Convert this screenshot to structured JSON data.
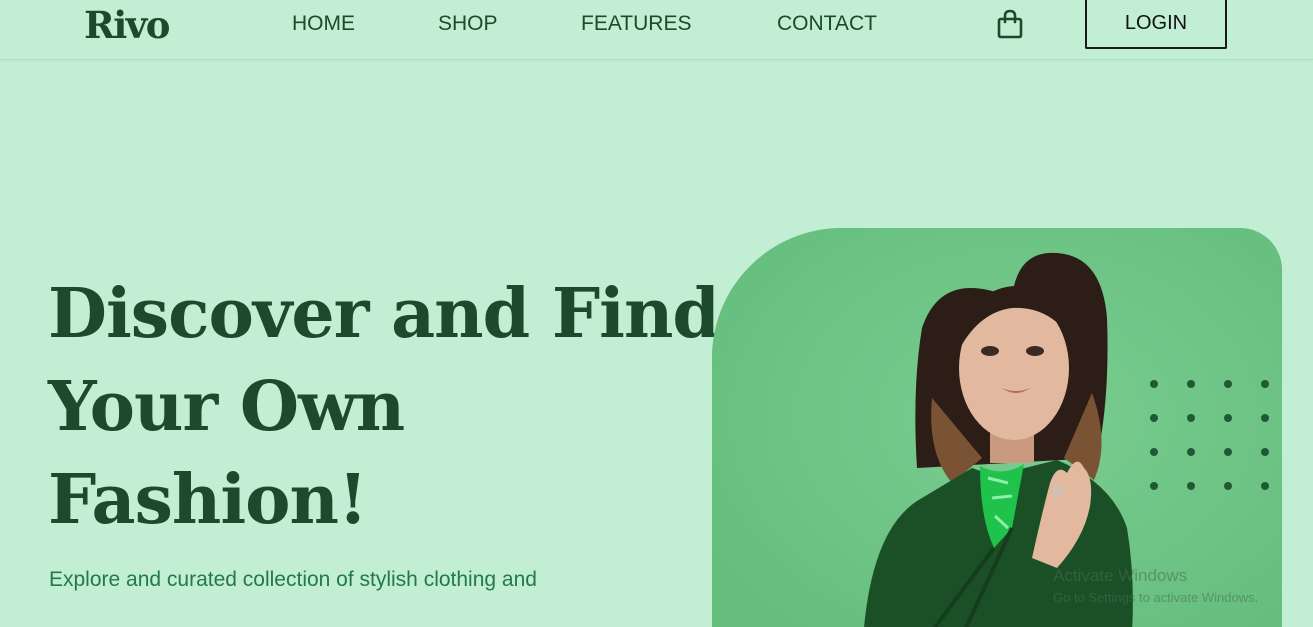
{
  "brand": {
    "logo_text": "Rivo"
  },
  "nav": {
    "links": [
      {
        "label": "HOME"
      },
      {
        "label": "SHOP"
      },
      {
        "label": "FEATURES"
      },
      {
        "label": "CONTACT"
      }
    ],
    "cart_icon": "shopping-bag-icon",
    "login_label": "LOGIN"
  },
  "hero": {
    "title_lines": [
      "Discover and Find",
      "Your Own",
      "Fashion!"
    ],
    "subtitle": "Explore and curated collection of stylish clothing and"
  },
  "overlay": {
    "title": "Activate Windows",
    "subtitle": "Go to Settings to activate Windows."
  },
  "colors": {
    "background": "#c2eed3",
    "primary_text": "#1d4a2d",
    "accent_text": "#237a48",
    "card": "#6cc383",
    "blazer": "#1b5026",
    "shirt": "#1fc24a"
  }
}
